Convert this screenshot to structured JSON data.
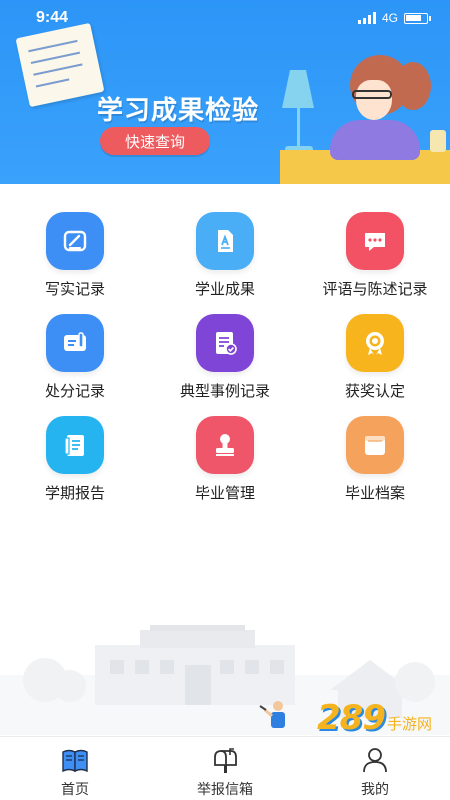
{
  "status_bar": {
    "time": "9:44",
    "network": "4G"
  },
  "banner": {
    "title": "学习成果检验",
    "button_label": "快速查询"
  },
  "grid": {
    "items": [
      {
        "label": "写实记录",
        "icon": "edit-note-icon",
        "color": "#3d8ff6"
      },
      {
        "label": "学业成果",
        "icon": "document-a-icon",
        "color": "#4aaef7"
      },
      {
        "label": "评语与陈述记录",
        "icon": "chat-bubble-icon",
        "color": "#f25264"
      },
      {
        "label": "处分记录",
        "icon": "card-pen-icon",
        "color": "#3d8ff6"
      },
      {
        "label": "典型事例记录",
        "icon": "checklist-icon",
        "color": "#7f45d6"
      },
      {
        "label": "获奖认定",
        "icon": "award-badge-icon",
        "color": "#f7b41d"
      },
      {
        "label": "学期报告",
        "icon": "report-book-icon",
        "color": "#25b4f0"
      },
      {
        "label": "毕业管理",
        "icon": "stamp-icon",
        "color": "#f0566a"
      },
      {
        "label": "毕业档案",
        "icon": "archive-folder-icon",
        "color": "#f5a35c"
      }
    ]
  },
  "watermark": {
    "number": "289",
    "suffix": "手游网"
  },
  "tab_bar": {
    "tabs": [
      {
        "label": "首页",
        "icon": "home-book-icon",
        "active": true
      },
      {
        "label": "举报信箱",
        "icon": "mailbox-icon",
        "active": false
      },
      {
        "label": "我的",
        "icon": "profile-icon",
        "active": false
      }
    ]
  }
}
